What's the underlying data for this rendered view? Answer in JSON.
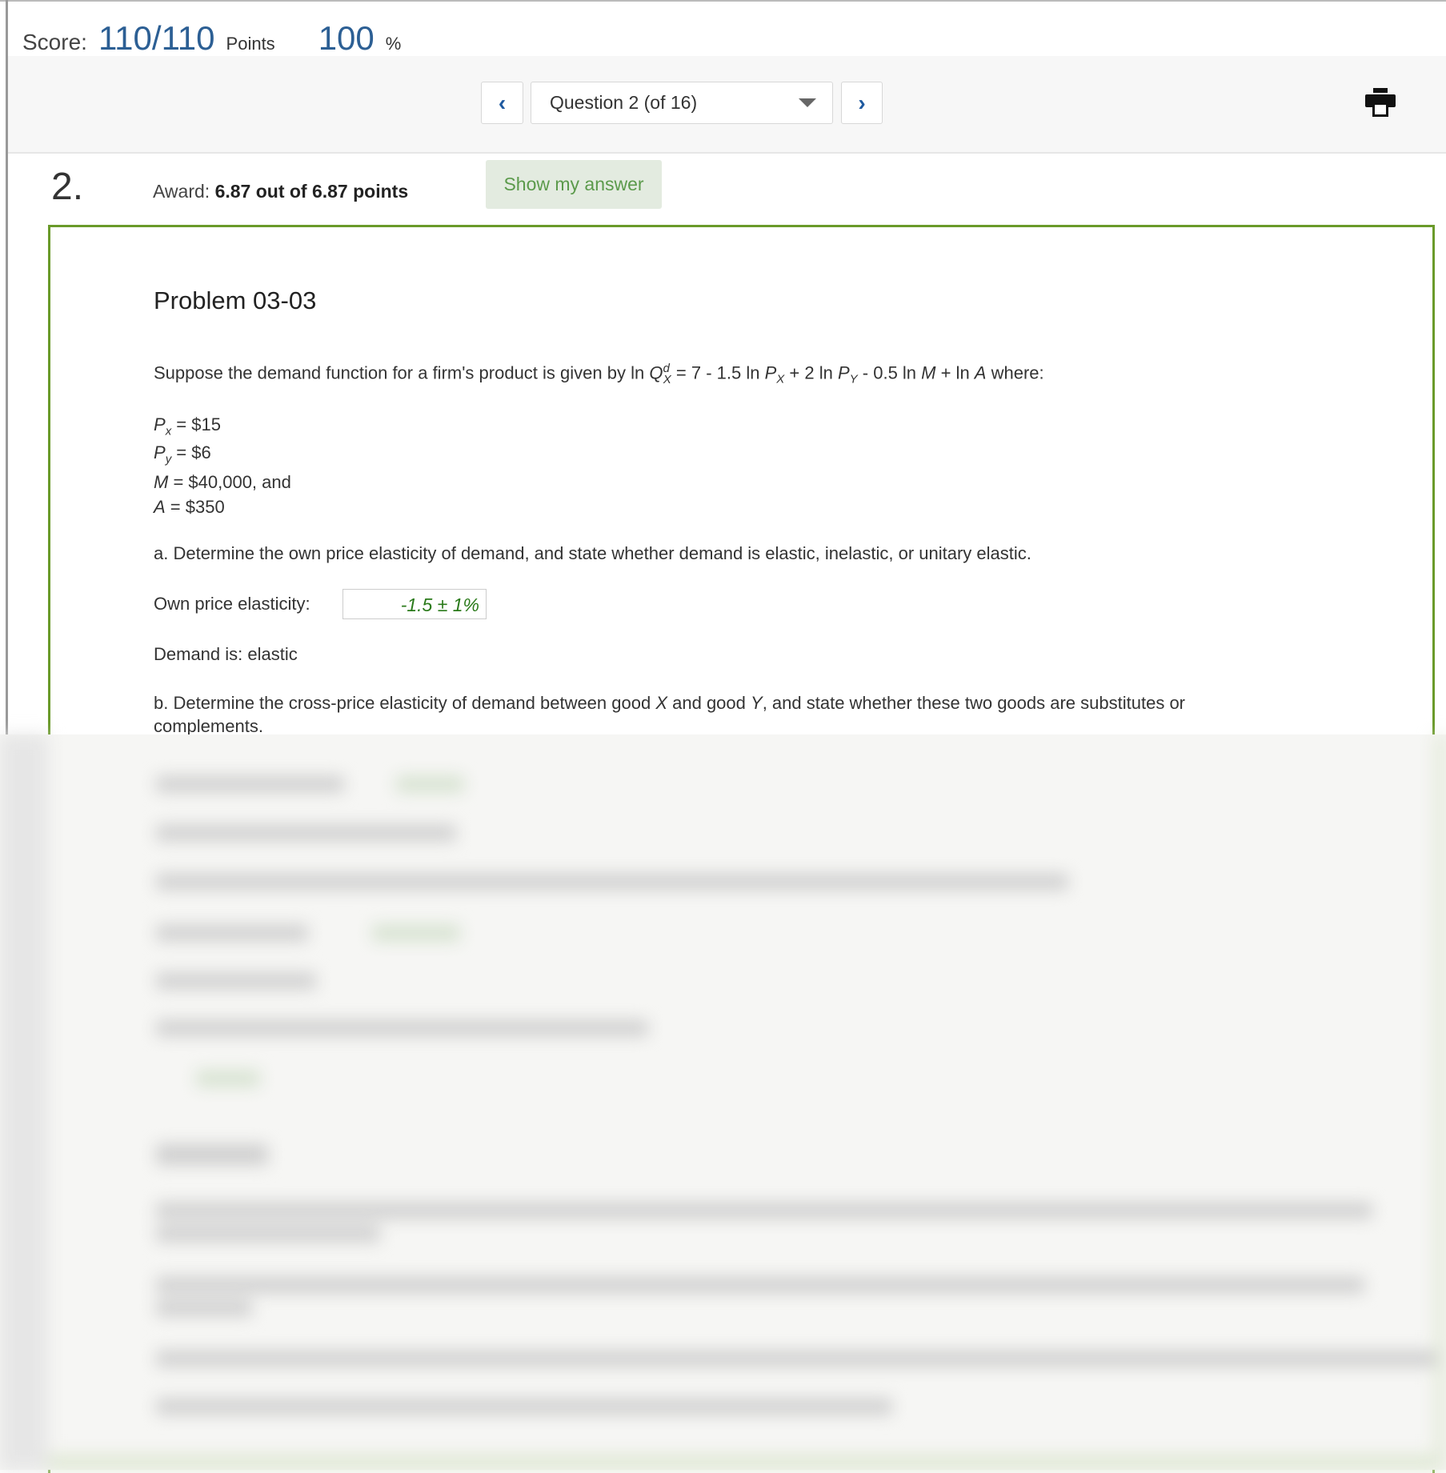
{
  "header": {
    "score_label": "Score:",
    "score_value": "110/110",
    "points_label": "Points",
    "percent_value": "100",
    "percent_sign": "%"
  },
  "nav": {
    "prev_icon": "chevron-left-icon",
    "next_icon": "chevron-right-icon",
    "question_select": "Question 2 (of 16)",
    "print_icon": "printer-icon"
  },
  "question": {
    "number": "2.",
    "award_label": "Award:",
    "award_value": "6.87 out of 6.87 points",
    "show_answer": "Show my answer"
  },
  "problem": {
    "title": "Problem 03-03",
    "intro_start": "Suppose the demand function for a firm's product is given by ln ",
    "intro_q": "Q",
    "intro_q_sub": "X",
    "intro_q_sup": "d",
    "intro_mid1": " = 7 - 1.5 ln ",
    "p": "P",
    "x_sub": "X",
    "intro_mid2": " + 2 ln ",
    "y_sub": "Y",
    "intro_mid3": " - 0.5 ln ",
    "m": "M",
    "intro_mid4": " + ln ",
    "a": "A",
    "intro_end": " where:",
    "givens": [
      {
        "var": "P",
        "sub": "x",
        "rest": " = $15"
      },
      {
        "var": "P",
        "sub": "y",
        "rest": " = $6"
      },
      {
        "var": "M",
        "sub": "",
        "rest": " = $40,000, and"
      },
      {
        "var": "A",
        "sub": "",
        "rest": " = $350"
      }
    ],
    "part_a": "a. Determine the own price elasticity of demand, and state whether demand is elastic, inelastic, or unitary elastic.",
    "own_label": "Own price elasticity:",
    "own_answer": "-1.5 ± 1%",
    "demand_is": "Demand is: elastic",
    "part_b_1": "b. Determine the cross-price elasticity of demand between good ",
    "part_b_x": "X",
    "part_b_2": " and good ",
    "part_b_y": "Y",
    "part_b_3": ", and state whether these two goods are substitutes or",
    "part_b_4": "complements."
  },
  "colors": {
    "accent_blue": "#2c5f94",
    "border_green": "#6a9a2a",
    "answer_green": "#2a7a1a"
  }
}
